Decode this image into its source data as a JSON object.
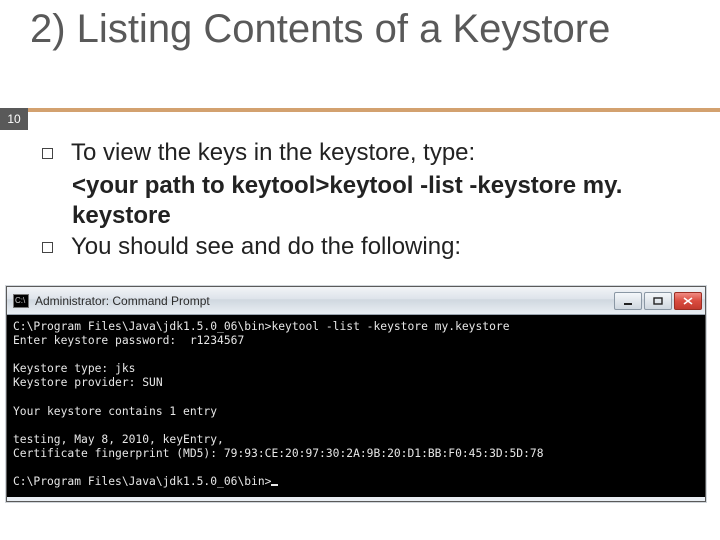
{
  "page_number": "10",
  "title": "2) Listing Contents of a Keystore",
  "bullets": [
    {
      "text": "To view the keys in the keystore, type:"
    },
    {
      "text": "You should see and do the following:"
    }
  ],
  "command_line": {
    "prefix": "<your path to keytool>",
    "cmd": "keytool -list -keystore my. keystore"
  },
  "cmd_window": {
    "title": "Administrator: Command Prompt",
    "icon_label": "C:\\",
    "console": "C:\\Program Files\\Java\\jdk1.5.0_06\\bin>keytool -list -keystore my.keystore\nEnter keystore password:  r1234567\n\nKeystore type: jks\nKeystore provider: SUN\n\nYour keystore contains 1 entry\n\ntesting, May 8, 2010, keyEntry,\nCertificate fingerprint (MD5): 79:93:CE:20:97:30:2A:9B:20:D1:BB:F0:45:3D:5D:78\n\nC:\\Program Files\\Java\\jdk1.5.0_06\\bin>"
  }
}
